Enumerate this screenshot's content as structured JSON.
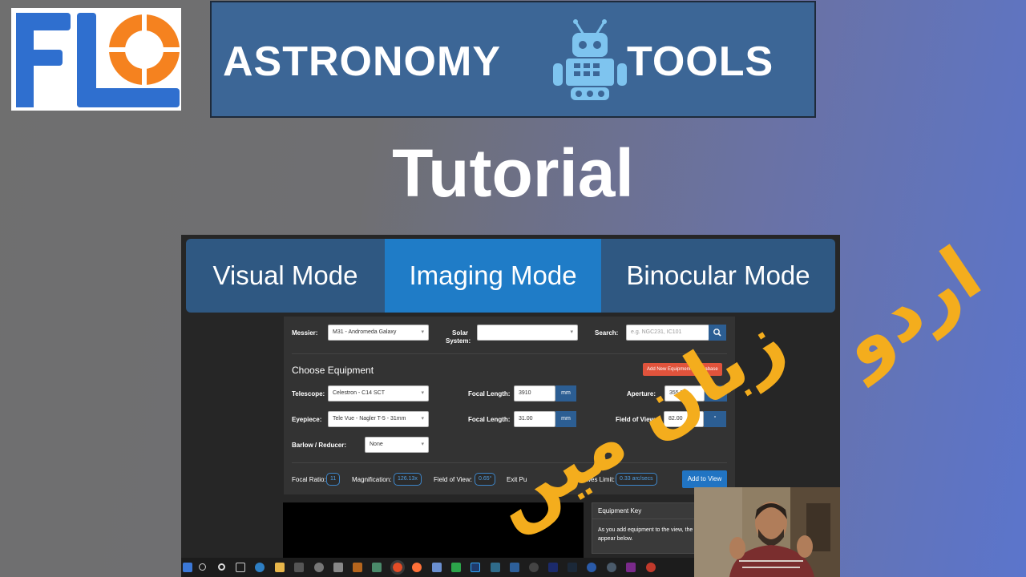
{
  "header": {
    "brand_left": "ASTRONOMY",
    "brand_right": "TOOLS",
    "title": "Tutorial"
  },
  "modes": {
    "visual": "Visual Mode",
    "imaging": "Imaging Mode",
    "binocular": "Binocular Mode"
  },
  "selectors": {
    "messier_label": "Messier:",
    "messier_value": "M31 - Andromeda Galaxy",
    "solar_label_1": "Solar",
    "solar_label_2": "System:",
    "solar_value": "",
    "search_label": "Search:",
    "search_placeholder": "e.g. NGC231, IC101"
  },
  "equipment": {
    "section_title": "Choose Equipment",
    "add_database_button": "Add New Equipment to Database",
    "telescope_label": "Telescope:",
    "telescope_value": "Celestron - C14 SCT",
    "telescope_focal_label": "Focal Length:",
    "telescope_focal_value": "3910",
    "telescope_focal_unit": "mm",
    "aperture_label": "Aperture:",
    "aperture_value": "355.50",
    "aperture_unit": "mm",
    "eyepiece_label": "Eyepiece:",
    "eyepiece_value": "Tele Vue - Nagler T-5 - 31mm",
    "eyepiece_focal_label": "Focal Length:",
    "eyepiece_focal_value": "31.00",
    "eyepiece_focal_unit": "mm",
    "fov_label": "Field of View:",
    "fov_value": "82.00",
    "fov_unit": "°",
    "barlow_label": "Barlow / Reducer:",
    "barlow_value": "None"
  },
  "results": {
    "focal_ratio_label": "Focal Ratio:",
    "focal_ratio_value": "11",
    "magnification_label": "Magnification:",
    "magnification_value": "126.13x",
    "fov_label": "Field of View:",
    "fov_value": "0.65°",
    "exit_pupil_label": "Exit Pu",
    "dawes_label": "Dawes Limit:",
    "dawes_value": "0.33 arc/secs",
    "add_to_view_button": "Add to View"
  },
  "equipment_key": {
    "heading": "Equipment Key",
    "body_line1": "As you add equipment to the view, the",
    "body_line2": "appear below."
  },
  "overlay": {
    "urdu_line1": "اردو",
    "urdu_line2": "زبان میں"
  },
  "colors": {
    "flo_blue": "#2f6fcf",
    "flo_orange": "#f5821f",
    "banner_blue": "#3c6696",
    "imaging_tab": "#1f7cc7",
    "urdu_text": "#f4ad1d",
    "add_db_button": "#e0533c",
    "add_view_button": "#2174c3"
  }
}
